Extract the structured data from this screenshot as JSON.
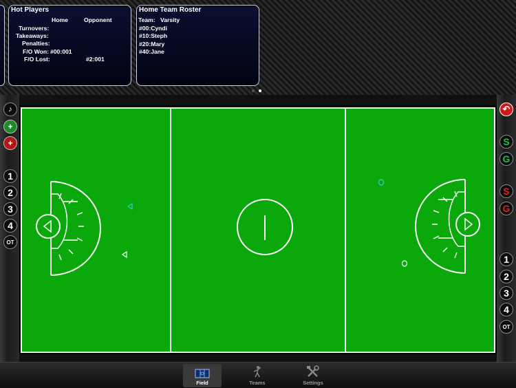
{
  "hot_players": {
    "title": "Hot Players",
    "col_home": "Home",
    "col_opponent": "Opponent",
    "rows": [
      {
        "label": "Turnovers:",
        "home": "",
        "opp": ""
      },
      {
        "label": "Takeaways:",
        "home": "",
        "opp": ""
      },
      {
        "label": "Penalties:",
        "home": "",
        "opp": ""
      },
      {
        "label": "F/O Won:",
        "home": "#00:001",
        "opp": ""
      },
      {
        "label": "F/O Lost:",
        "home": "",
        "opp": "#2:001"
      }
    ]
  },
  "roster": {
    "title": "Home Team Roster",
    "team_label": "Team:",
    "team_name": "Varsity",
    "players": [
      "#00:Cyndi",
      "#10:Steph",
      "#20:Mary",
      "#40:Jane"
    ]
  },
  "left_controls": {
    "periods": [
      "1",
      "2",
      "3",
      "4",
      "OT"
    ]
  },
  "right_controls": {
    "top_pair": [
      {
        "text": "S",
        "color": "#22c14a"
      },
      {
        "text": "G",
        "color": "#22c14a"
      }
    ],
    "bottom_pair": [
      {
        "text": "S",
        "color": "#e02020"
      },
      {
        "text": "G",
        "color": "#e02020"
      }
    ],
    "periods": [
      "1",
      "2",
      "3",
      "4",
      "OT"
    ]
  },
  "colors": {
    "field_green": "#0aa80a",
    "marker_cyan": "#28d0d0"
  },
  "tabs": [
    {
      "label": "Field",
      "icon": "field-icon",
      "active": true
    },
    {
      "label": "Teams",
      "icon": "player-icon",
      "active": false
    },
    {
      "label": "Settings",
      "icon": "tools-icon",
      "active": false
    }
  ]
}
